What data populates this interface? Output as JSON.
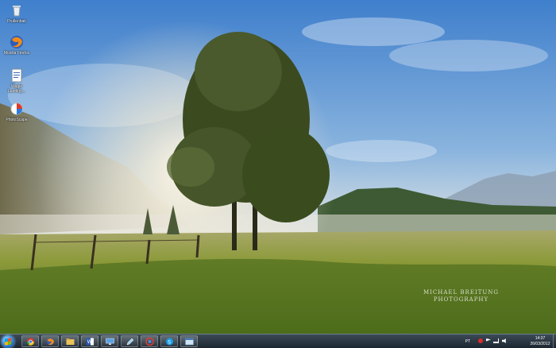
{
  "desktop": {
    "icons": [
      {
        "label": "Prullenbak",
        "icon": "recycle-bin-icon"
      },
      {
        "label": "Mozilla Firefox",
        "icon": "firefox-icon"
      },
      {
        "label": "Wagle Leerling...",
        "icon": "document-icon"
      },
      {
        "label": "PhotoScape",
        "icon": "photoscape-icon"
      }
    ],
    "watermark": {
      "line1": "MICHAEL BREITUNG",
      "line2": "PHOTOGRAPHY"
    }
  },
  "taskbar": {
    "apps": [
      {
        "name": "chrome",
        "icon": "chrome-icon"
      },
      {
        "name": "firefox",
        "icon": "firefox-icon"
      },
      {
        "name": "explorer",
        "icon": "folder-icon"
      },
      {
        "name": "word",
        "icon": "word-icon"
      },
      {
        "name": "monitor",
        "icon": "monitor-icon"
      },
      {
        "name": "pen",
        "icon": "pen-icon"
      },
      {
        "name": "picasa",
        "icon": "picasa-icon"
      },
      {
        "name": "skype",
        "icon": "skype-icon"
      },
      {
        "name": "window",
        "icon": "window-icon"
      }
    ],
    "tray": {
      "language": "PT",
      "icons": [
        "record-icon",
        "flag-icon",
        "network-icon",
        "volume-icon"
      ]
    },
    "clock": {
      "time": "14:37",
      "date": "26/03/2012"
    }
  },
  "colors": {
    "taskbar": "#1c2630",
    "sky": "#4b8ad0",
    "grass": "#5a7a1e"
  }
}
